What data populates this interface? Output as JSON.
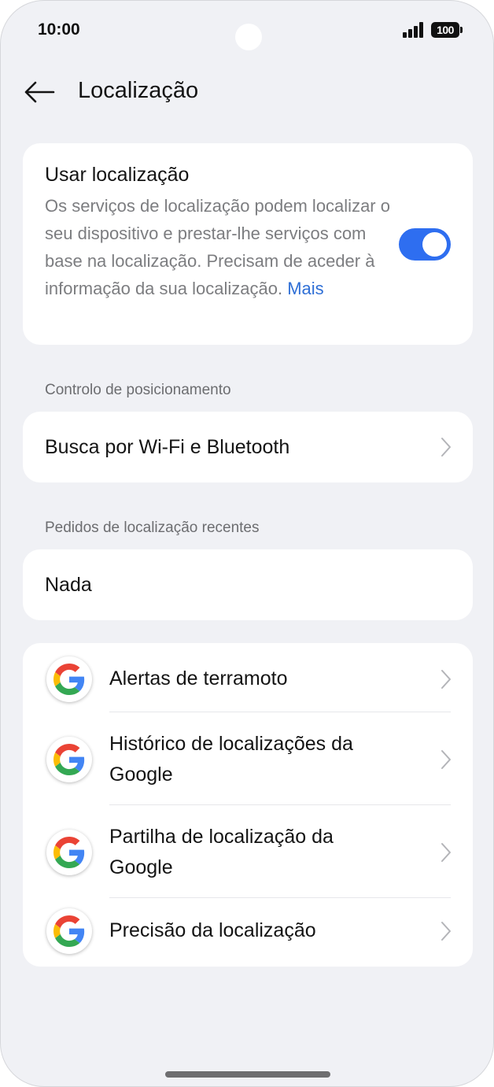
{
  "status_bar": {
    "time": "10:00",
    "battery": "100"
  },
  "header": {
    "title": "Localização"
  },
  "location_card": {
    "title": "Usar localização",
    "description": "Os serviços de localização podem localizar o seu dispositivo e prestar-lhe serviços com base na localização. Precisam de aceder à informação da sua localização.",
    "more_link": "Mais",
    "toggle_on": true
  },
  "positioning_section": {
    "label": "Controlo de posicionamento",
    "item": "Busca por Wi-Fi e Bluetooth"
  },
  "recent_section": {
    "label": "Pedidos de localização recentes",
    "empty_text": "Nada"
  },
  "google_services": [
    {
      "label": "Alertas de terramoto",
      "icon": "google-icon"
    },
    {
      "label": "Histórico de localizações da Google",
      "icon": "google-icon"
    },
    {
      "label": "Partilha de localização da Google",
      "icon": "google-icon"
    },
    {
      "label": "Precisão da localização",
      "icon": "google-icon"
    }
  ],
  "colors": {
    "accent": "#2e6ef0",
    "link": "#2f6fd6",
    "background": "#f0f1f5"
  }
}
